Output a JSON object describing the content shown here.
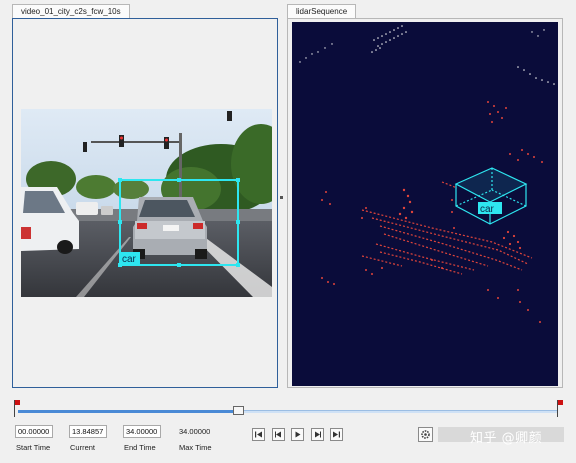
{
  "tabs": {
    "video": "video_01_city_c2s_fcw_10s",
    "lidar": "lidarSequence"
  },
  "labels": {
    "video_box": "car",
    "lidar_box": "car"
  },
  "playback": {
    "start_time_value": "00.00000",
    "start_time_label": "Start Time",
    "current_value": "13.84857",
    "current_label": "Current",
    "end_time_value": "34.00000",
    "end_time_label": "End Time",
    "max_time_value": "34.00000",
    "max_time_label": "Max Time",
    "progress_fraction": 0.4073
  },
  "controls": [
    "skip-to-start-icon",
    "step-back-icon",
    "play-icon",
    "step-forward-icon",
    "skip-to-end-icon"
  ],
  "watermark": "知乎 @卿颜",
  "colors": {
    "lidar_background": "#0a0c3a",
    "lidar_points": "#e2453a",
    "box_cyan": "#2ee6f0",
    "track_fill": "#4a8ad6"
  }
}
